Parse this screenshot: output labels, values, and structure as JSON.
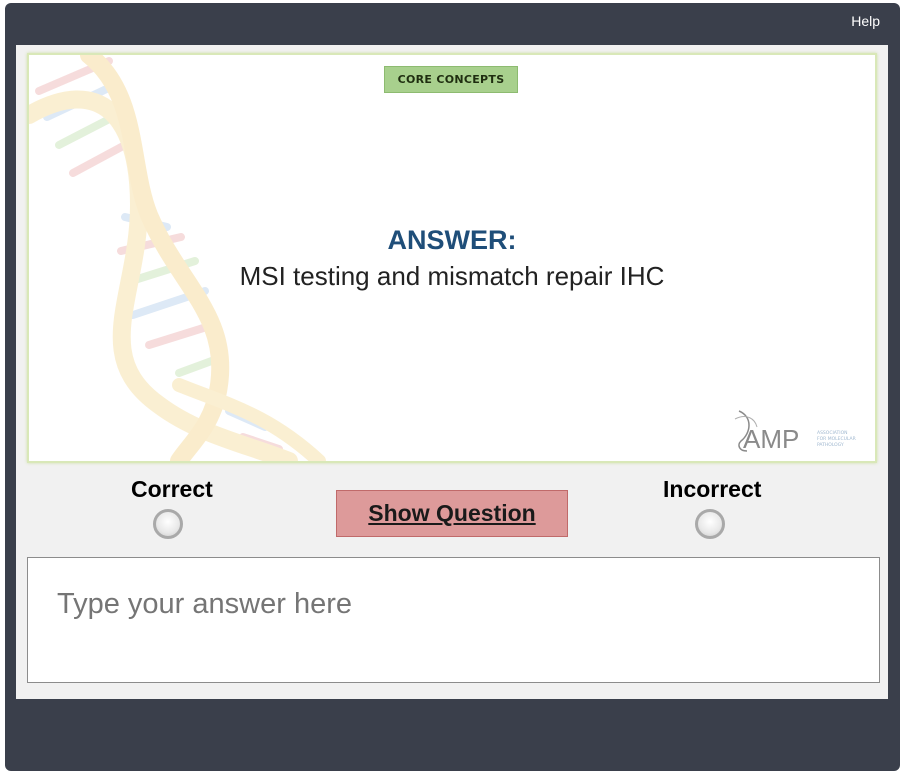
{
  "player": {
    "help_label": "Help"
  },
  "slide": {
    "badge": "CORE CONCEPTS",
    "answer_heading": "ANSWER:",
    "answer_text": "MSI testing and mismatch repair IHC",
    "logo": {
      "name": "AMP",
      "tagline": [
        "ASSOCIATION",
        "FOR MOLECULAR",
        "PATHOLOGY"
      ]
    }
  },
  "controls": {
    "correct_label": "Correct",
    "incorrect_label": "Incorrect",
    "show_question_label": "Show Question"
  },
  "answer_input": {
    "placeholder": "Type your answer here",
    "value": ""
  }
}
